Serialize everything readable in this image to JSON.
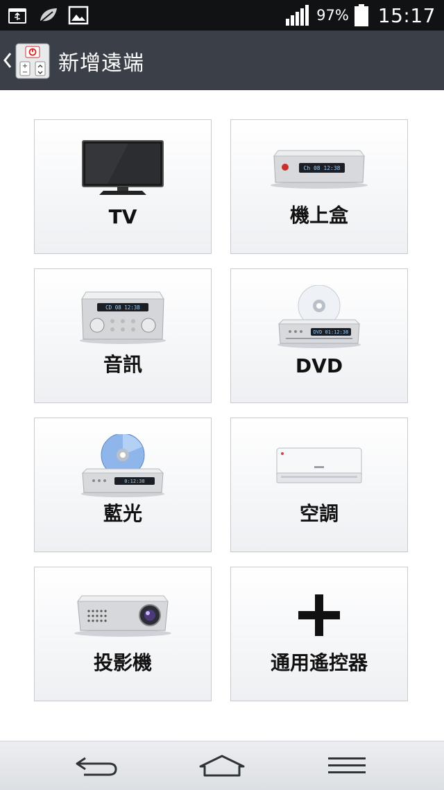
{
  "status_bar": {
    "battery_percent": "97%",
    "time": "15:17",
    "icons": [
      "usb-icon",
      "leaf-icon",
      "image-icon",
      "signal-icon",
      "battery-icon"
    ]
  },
  "app_bar": {
    "title": "新增遠端",
    "icon": "remote-app-icon"
  },
  "devices": [
    {
      "label": "TV",
      "icon": "tv-icon"
    },
    {
      "label": "機上盒",
      "icon": "set-top-box-icon",
      "display": "Ch 08  12:38"
    },
    {
      "label": "音訊",
      "icon": "audio-receiver-icon",
      "display": "CD 08  12:38"
    },
    {
      "label": "DVD",
      "icon": "dvd-player-icon",
      "display": "DVD  01:12:38"
    },
    {
      "label": "藍光",
      "icon": "bluray-player-icon",
      "display": "0:12:38"
    },
    {
      "label": "空調",
      "icon": "air-conditioner-icon"
    },
    {
      "label": "投影機",
      "icon": "projector-icon"
    },
    {
      "label": "通用遙控器",
      "icon": "plus-icon"
    }
  ],
  "nav_bar": {
    "buttons": [
      "back-icon",
      "home-icon",
      "menu-icon"
    ]
  },
  "colors": {
    "status_bar": "#111214",
    "app_bar": "#3b4048",
    "tile_border": "#c9cbcf",
    "nav_bar": "#e4e6e9"
  }
}
